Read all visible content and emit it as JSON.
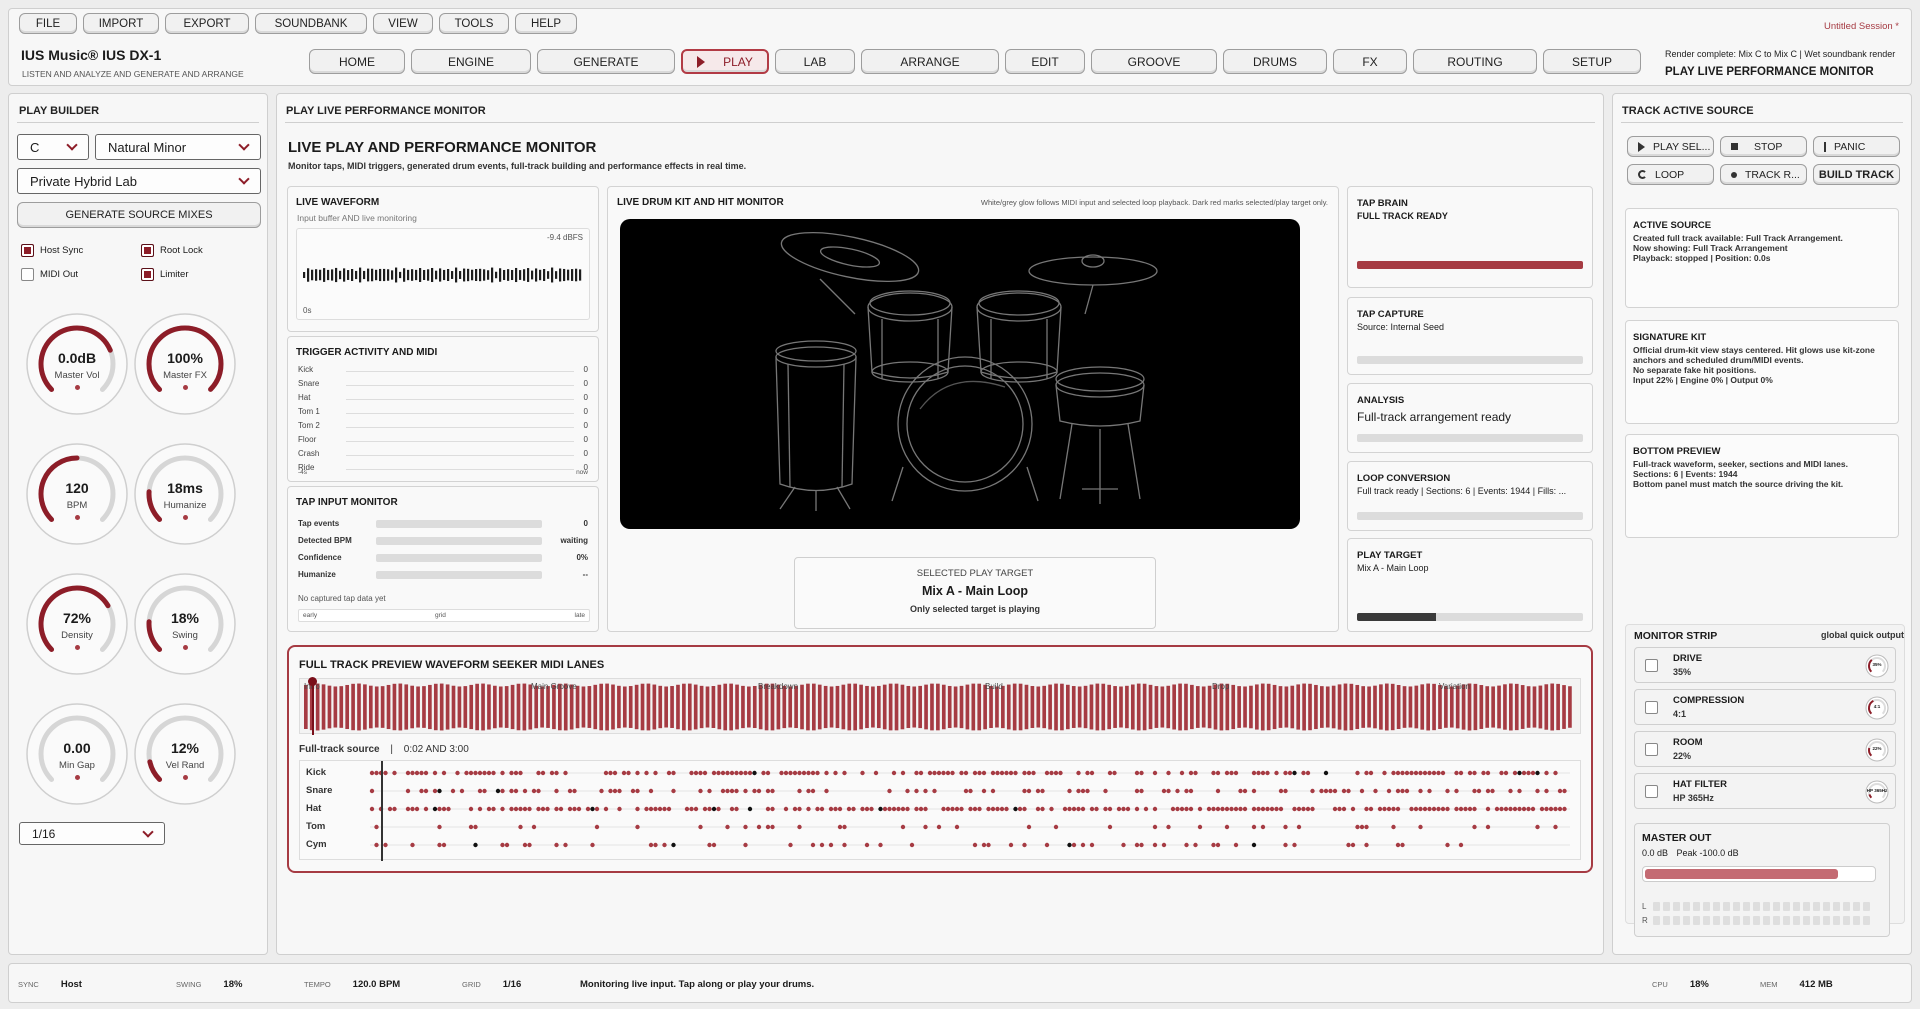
{
  "app": {
    "title": "IUS Music® IUS DX-1",
    "subtitle": "LISTEN AND ANALYZE AND GENERATE AND ARRANGE",
    "session": "Untitled Session *",
    "render_status": "Render complete: Mix C to Mix C | Wet soundbank render",
    "page_title": "PLAY LIVE PERFORMANCE MONITOR",
    "accent_color": "#a63b43"
  },
  "menu": [
    "FILE",
    "IMPORT",
    "EXPORT",
    "SOUNDBANK",
    "VIEW",
    "TOOLS",
    "HELP"
  ],
  "nav": [
    "HOME",
    "ENGINE",
    "GENERATE",
    "PLAY",
    "LAB",
    "ARRANGE",
    "EDIT",
    "GROOVE",
    "DRUMS",
    "FX",
    "ROUTING",
    "SETUP"
  ],
  "nav_active": "PLAY",
  "builder": {
    "title": "PLAY BUILDER",
    "key": "C",
    "scale": "Natural Minor",
    "lab": "Private Hybrid Lab",
    "generate": "GENERATE SOURCE MIXES",
    "checks": [
      {
        "label": "Host Sync",
        "on": true
      },
      {
        "label": "Root Lock",
        "on": true
      },
      {
        "label": "MIDI Out",
        "on": false
      },
      {
        "label": "Limiter",
        "on": true
      }
    ],
    "knobs": [
      {
        "value": "0.0dB",
        "label": "Master Vol",
        "level": 0.75
      },
      {
        "value": "100%",
        "label": "Master FX",
        "level": 1.0
      },
      {
        "value": "120",
        "label": "BPM",
        "level": 0.5
      },
      {
        "value": "18ms",
        "label": "Humanize",
        "level": 0.18
      },
      {
        "value": "72%",
        "label": "Density",
        "level": 0.72
      },
      {
        "value": "18%",
        "label": "Swing",
        "level": 0.18
      },
      {
        "value": "0.00",
        "label": "Min Gap",
        "level": 0.0
      },
      {
        "value": "12%",
        "label": "Vel Rand",
        "level": 0.12
      }
    ],
    "grid": "1/16"
  },
  "monitor": {
    "title": "PLAY LIVE PERFORMANCE MONITOR",
    "heading": "LIVE PLAY AND PERFORMANCE MONITOR",
    "desc": "Monitor taps, MIDI triggers, generated drum events, full-track building and performance effects in real time.",
    "waveform": {
      "title": "LIVE WAVEFORM",
      "sub": "Input buffer AND live monitoring",
      "db": "-9.4 dBFS",
      "time": "0s"
    },
    "trigger": {
      "title": "TRIGGER ACTIVITY AND MIDI",
      "rows": [
        {
          "n": "Kick",
          "v": "0"
        },
        {
          "n": "Snare",
          "v": "0"
        },
        {
          "n": "Hat",
          "v": "0"
        },
        {
          "n": "Tom 1",
          "v": "0"
        },
        {
          "n": "Tom 2",
          "v": "0"
        },
        {
          "n": "Floor",
          "v": "0"
        },
        {
          "n": "Crash",
          "v": "0"
        },
        {
          "n": "Ride",
          "v": "0"
        }
      ],
      "axis_start": "-4s",
      "axis_end": "now"
    },
    "tap": {
      "title": "TAP INPUT MONITOR",
      "rows": [
        {
          "n": "Tap events",
          "v": "0"
        },
        {
          "n": "Detected BPM",
          "v": "waiting"
        },
        {
          "n": "Confidence",
          "v": "0%"
        },
        {
          "n": "Humanize",
          "v": "--"
        }
      ],
      "note": "No captured tap data yet",
      "scale": [
        "early",
        "grid",
        "late"
      ]
    },
    "drumkit": {
      "title": "LIVE DRUM KIT AND HIT MONITOR",
      "note": "White/grey glow follows MIDI input and selected loop playback. Dark red marks selected/play target only."
    },
    "target": {
      "label": "SELECTED PLAY TARGET",
      "name": "Mix A - Main Loop",
      "note": "Only selected target is playing"
    },
    "side": [
      {
        "title": "TAP BRAIN",
        "text": "FULL TRACK READY",
        "bold": true,
        "fill": 1.0,
        "dark": false
      },
      {
        "title": "TAP CAPTURE",
        "text": "Source: Internal Seed",
        "bold": false,
        "fill": 0.0,
        "dark": false
      },
      {
        "title": "ANALYSIS",
        "text": "Full-track arrangement ready",
        "bold": false,
        "fill": 0.0,
        "dark": false
      },
      {
        "title": "LOOP CONVERSION",
        "text": "Full track ready | Sections: 6 | Events: 1944 | Fills: ...",
        "bold": false,
        "fill": 0.0,
        "dark": false
      },
      {
        "title": "PLAY TARGET",
        "text": "Mix A - Main Loop",
        "bold": false,
        "fill": 0.35,
        "dark": true
      }
    ],
    "preview": {
      "title": "FULL TRACK PREVIEW WAVEFORM SEEKER MIDI LANES",
      "sections": [
        "Intro",
        "Main Groove",
        "Breakdown",
        "Build",
        "Drop",
        "Variation"
      ],
      "source": "Full-track source",
      "time": "0:02 AND 3:00",
      "lanes": [
        "Kick",
        "Snare",
        "Hat",
        "Tom",
        "Cym"
      ]
    }
  },
  "source": {
    "title": "TRACK ACTIVE SOURCE",
    "buttons": [
      "PLAY SEL...",
      "STOP",
      "PANIC",
      "LOOP",
      "TRACK R...",
      "BUILD TRACK"
    ],
    "cards": [
      {
        "title": "ACTIVE SOURCE",
        "lines": [
          "Created full track available: Full Track Arrangement.",
          "Now showing: Full Track Arrangement",
          "Playback: stopped | Position: 0.0s"
        ]
      },
      {
        "title": "SIGNATURE KIT",
        "lines": [
          "Official drum-kit view stays centered. Hit glows use kit-zone",
          "anchors and scheduled drum/MIDI events.",
          "No separate fake hit positions.",
          "Input 22% | Engine 0% | Output 0%"
        ]
      },
      {
        "title": "BOTTOM PREVIEW",
        "lines": [
          "Full-track waveform, seeker, sections and MIDI lanes.",
          "Sections: 6 | Events: 1944",
          "Bottom panel must match the source driving the kit."
        ]
      }
    ],
    "strip": {
      "title": "MONITOR STRIP",
      "scope": "global quick output",
      "items": [
        {
          "name": "DRIVE",
          "value": "35%",
          "knob": "35%",
          "level": 0.35
        },
        {
          "name": "COMPRESSION",
          "value": "4:1",
          "knob": "4:1",
          "level": 0.4
        },
        {
          "name": "ROOM",
          "value": "22%",
          "knob": "22%",
          "level": 0.22
        },
        {
          "name": "HAT FILTER",
          "value": "HP 365Hz",
          "knob": "HP 365Hz",
          "level": 0.1
        }
      ]
    },
    "master": {
      "title": "MASTER OUT",
      "vol": "0.0 dB",
      "peak": "Peak -100.0 dB",
      "level": 0.83,
      "l": "L",
      "r": "R"
    }
  },
  "status": {
    "sync": {
      "k": "SYNC",
      "v": "Host"
    },
    "swing": {
      "k": "SWING",
      "v": "18%"
    },
    "tempo": {
      "k": "TEMPO",
      "v": "120.0 BPM"
    },
    "grid": {
      "k": "GRID",
      "v": "1/16"
    },
    "message": "Monitoring live input. Tap along or play your drums.",
    "cpu": {
      "k": "CPU",
      "v": "18%"
    },
    "mem": {
      "k": "MEM",
      "v": "412 MB"
    }
  }
}
